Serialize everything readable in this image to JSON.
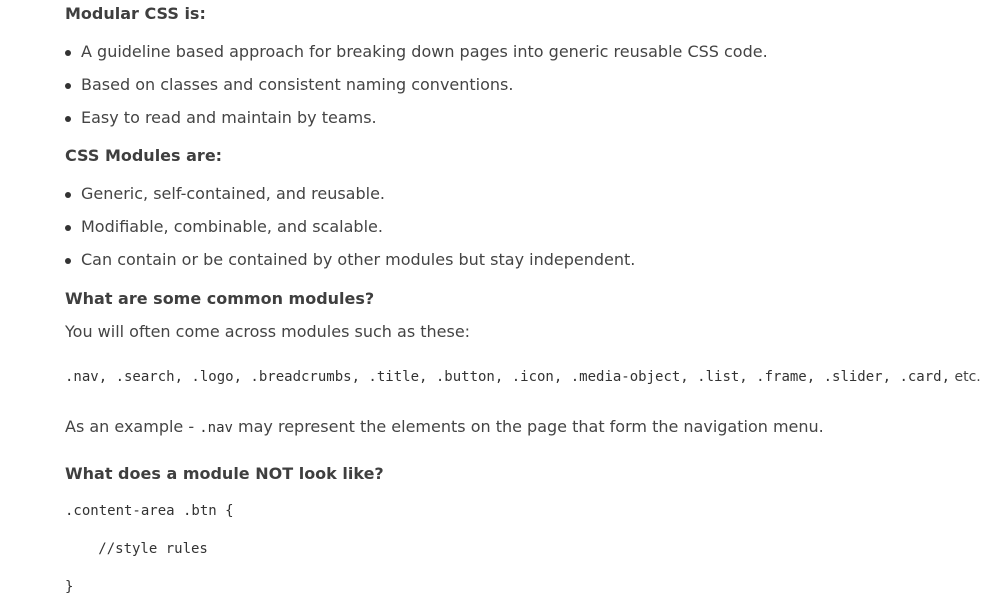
{
  "section1": {
    "heading": "Modular CSS is:",
    "items": [
      "A guideline based approach for breaking down pages into generic reusable CSS code.",
      "Based on classes and consistent naming conventions.",
      "Easy to read and maintain by teams."
    ]
  },
  "section2": {
    "heading": "CSS Modules are:",
    "items": [
      "Generic, self-contained, and reusable.",
      "Modifiable, combinable, and scalable.",
      "Can contain or be contained by other modules but stay independent."
    ]
  },
  "section3": {
    "heading": "What are some common modules?",
    "intro": "You will often come across modules such as these:",
    "modules_code": ".nav, .search, .logo, .breadcrumbs, .title, .button, .icon, .media-object, .list, .frame, .slider, .card,",
    "modules_suffix": " etc.",
    "example_prefix": "As an example - ",
    "example_code": ".nav",
    "example_suffix": " may represent the elements on the page that form the navigation menu."
  },
  "section4": {
    "heading": "What does a module NOT look like?",
    "code_lines": [
      ".content-area .btn {",
      "   //style rules",
      "}"
    ]
  }
}
